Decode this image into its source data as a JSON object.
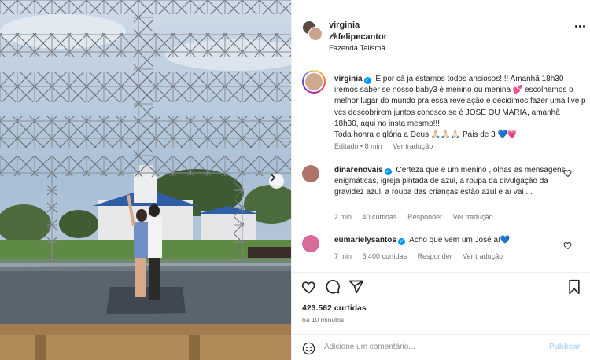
{
  "post": {
    "header": {
      "user1": "virginia",
      "joiner": "e",
      "user2": "zefelipecantor",
      "location": "Fazenda Talismã"
    },
    "caption": {
      "username": "virginia",
      "text": "E por cá ja estamos todos ansiosos!!!! Amanhã 18h30 iremos saber se nosso baby3 é menino ou menina 💕 escolhemos o melhor lugar do mundo pra essa revelação e decidimos fazer uma live p vcs descobrirem juntos conosco se é JOSÉ OU MARIA, amanhã 18h30, aqui no insta mesmo!!!",
      "text2": "Toda honra e glória a Deus 🙏🏻🙏🏻🙏🏻 Pais de 3 💙💗",
      "edited": "Editado • 8 min",
      "translate": "Ver tradução"
    },
    "comments": [
      {
        "username": "dinarenovais",
        "text": "Certeza que é um menino , olhas as mensagens enigmáticas, igreja pintada de azul, a roupa da divulgação da gravidez azul, a roupa das crianças estão azul e aí vai ...",
        "time": "2 min",
        "likes": "40 curtidas",
        "reply": "Responder",
        "translate": "Ver tradução",
        "avatar_color": "#b0736a"
      },
      {
        "username": "eumarielysantos",
        "text": "Acho que vem um José aí💙",
        "time": "7 min",
        "likes": "3.400 curtidas",
        "reply": "Responder",
        "translate": "Ver tradução",
        "avatar_color": "#d96b9a"
      }
    ],
    "icons": {
      "like": "heart-icon",
      "comment": "comment-icon",
      "share": "share-icon",
      "save": "bookmark-icon",
      "more": "more-icon",
      "emoji": "emoji-icon",
      "next": "chevron-right-icon"
    },
    "likes_count": "423.562 curtidas",
    "posted_ago": "há 10 minutos",
    "add_comment_placeholder": "Adicione um comentário...",
    "publish_label": "Publicar",
    "colors": {
      "accent_blue": "#0095f6",
      "publish_disabled": "#b3dbff",
      "muted": "#737373"
    }
  }
}
